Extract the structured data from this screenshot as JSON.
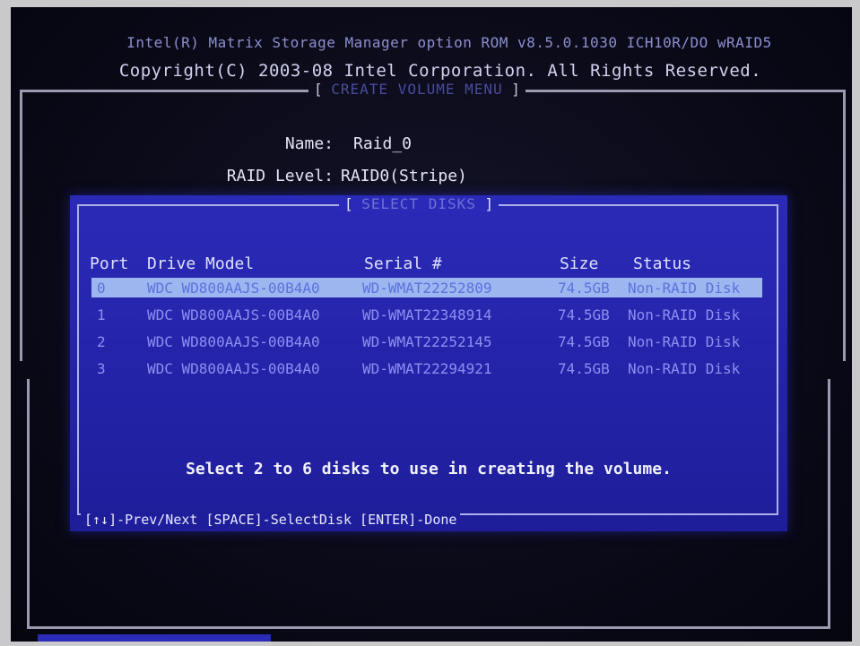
{
  "header": {
    "line1": "Intel(R) Matrix Storage Manager option ROM v8.5.0.1030 ICH10R/DO wRAID5",
    "line2": "Copyright(C) 2003-08 Intel Corporation.  All Rights Reserved."
  },
  "menu": {
    "title": "CREATE VOLUME MENU"
  },
  "fields": {
    "name_label": "Name:",
    "name_value": "Raid_0",
    "level_label": "RAID Level:",
    "level_value": "RAID0(Stripe)"
  },
  "dialog": {
    "title": "SELECT DISKS",
    "columns": {
      "port": "Port",
      "model": "Drive Model",
      "serial": "Serial #",
      "size": "Size",
      "status": "Status"
    },
    "disks": [
      {
        "port": "0",
        "model": "WDC WD800AAJS-00B4A0",
        "serial": "WD-WMAT22252809",
        "size": "74.5GB",
        "status": "Non-RAID Disk"
      },
      {
        "port": "1",
        "model": "WDC WD800AAJS-00B4A0",
        "serial": "WD-WMAT22348914",
        "size": "74.5GB",
        "status": "Non-RAID Disk"
      },
      {
        "port": "2",
        "model": "WDC WD800AAJS-00B4A0",
        "serial": "WD-WMAT22252145",
        "size": "74.5GB",
        "status": "Non-RAID Disk"
      },
      {
        "port": "3",
        "model": "WDC WD800AAJS-00B4A0",
        "serial": "WD-WMAT22294921",
        "size": "74.5GB",
        "status": "Non-RAID Disk"
      }
    ],
    "hint": "Select 2 to 6 disks to use in creating the volume.",
    "footer": "[↑↓]-Prev/Next [SPACE]-SelectDisk [ENTER]-Done"
  },
  "colors": {
    "dialog_bg": "#2a2ab8",
    "selected_row": "#9eb6f0",
    "screen_bg": "#0a0a18"
  }
}
